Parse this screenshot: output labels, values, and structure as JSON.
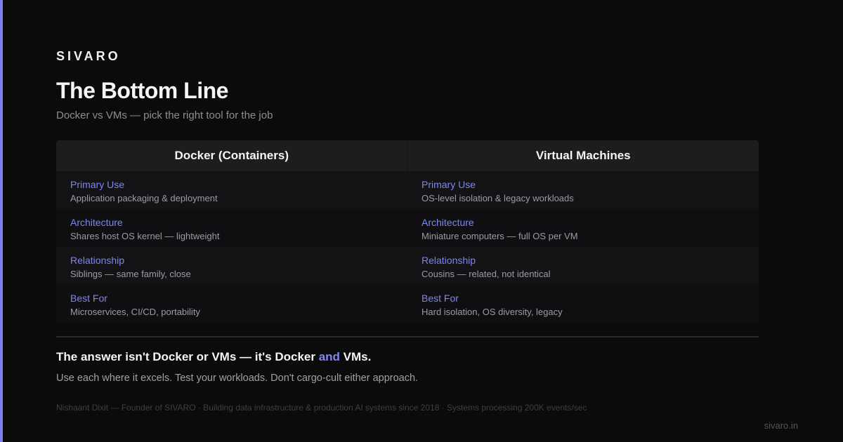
{
  "brand": "SIVARO",
  "title": "The Bottom Line",
  "subtitle": "Docker vs VMs — pick the right tool for the job",
  "colors": {
    "accent": "#7b80ee",
    "background": "#0b0b0c"
  },
  "table": {
    "columns": [
      "Docker (Containers)",
      "Virtual Machines"
    ],
    "rows": [
      {
        "docker": {
          "label": "Primary Use",
          "value": "Application packaging & deployment"
        },
        "vm": {
          "label": "Primary Use",
          "value": "OS-level isolation & legacy workloads"
        }
      },
      {
        "docker": {
          "label": "Architecture",
          "value": "Shares host OS kernel — lightweight"
        },
        "vm": {
          "label": "Architecture",
          "value": "Miniature computers — full OS per VM"
        }
      },
      {
        "docker": {
          "label": "Relationship",
          "value": "Siblings — same family, close"
        },
        "vm": {
          "label": "Relationship",
          "value": "Cousins — related, not identical"
        }
      },
      {
        "docker": {
          "label": "Best For",
          "value": "Microservices, CI/CD, portability"
        },
        "vm": {
          "label": "Best For",
          "value": "Hard isolation, OS diversity, legacy"
        }
      }
    ]
  },
  "conclusion": {
    "lead": "The answer isn't Docker or VMs — it's Docker ",
    "highlight": "and",
    "tail": " VMs.",
    "sub": "Use each where it excels. Test your workloads. Don't cargo-cult either approach."
  },
  "footer": "Nishaant Dixit — Founder of SIVARO · Building data infrastructure & production AI systems since 2018 · Systems processing 200K events/sec",
  "site": "sivaro.in"
}
